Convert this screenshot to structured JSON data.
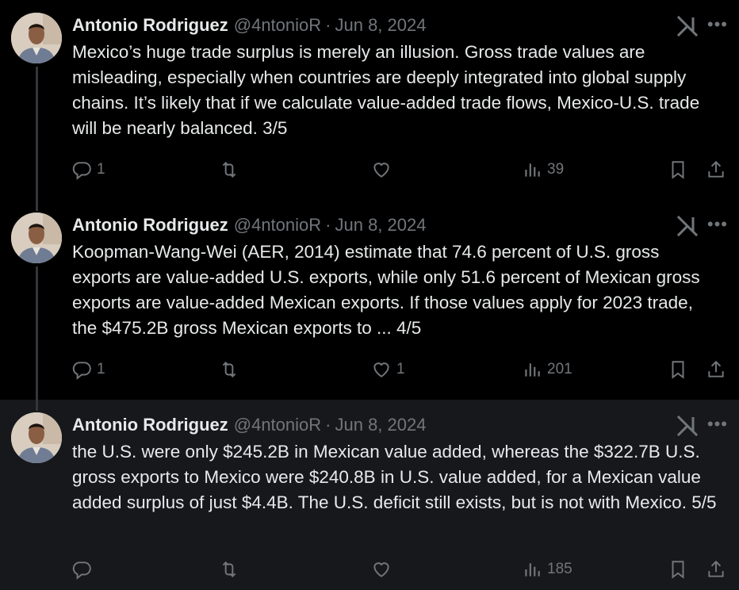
{
  "tweets": [
    {
      "author_name": "Antonio Rodriguez",
      "handle": "@4ntonioR",
      "separator": "·",
      "date": "Jun 8, 2024",
      "text": "Mexico’s huge trade surplus is merely an illusion. Gross trade values are misleading, especially when countries are deeply integrated into global supply chains. It’s likely that if we calculate value-added trade flows, Mexico-U.S. trade will be nearly balanced. 3/5",
      "replies": "1",
      "reposts": "",
      "likes": "",
      "views": "39"
    },
    {
      "author_name": "Antonio Rodriguez",
      "handle": "@4ntonioR",
      "separator": "·",
      "date": "Jun 8, 2024",
      "text": "Koopman-Wang-Wei (AER, 2014) estimate that 74.6 percent of U.S. gross exports are value-added U.S. exports, while only 51.6 percent of Mexican gross exports are value-added Mexican exports. If those values apply for 2023 trade, the $475.2B gross Mexican exports to ... 4/5",
      "replies": "1",
      "reposts": "",
      "likes": "1",
      "views": "201"
    },
    {
      "author_name": "Antonio Rodriguez",
      "handle": "@4ntonioR",
      "separator": "·",
      "date": "Jun 8, 2024",
      "text": "the U.S. were only $245.2B in Mexican value added, whereas the $322.7B U.S. gross exports to Mexico were $240.8B in U.S. value added, for a Mexican value added surplus of just $4.4B. The U.S. deficit still exists, but is not with Mexico. 5/5",
      "replies": "",
      "reposts": "",
      "likes": "",
      "views": "185"
    }
  ],
  "icons": {
    "reply": "reply-icon",
    "repost": "repost-icon",
    "like": "heart-icon",
    "views": "views-icon",
    "bookmark": "bookmark-icon",
    "share": "share-icon",
    "grok": "grok-icon",
    "more": "more-icon"
  },
  "colors": {
    "background": "#000000",
    "highlight_background": "#16181c",
    "text": "#e7e9ea",
    "muted": "#71767b",
    "thread_line": "#333639"
  }
}
